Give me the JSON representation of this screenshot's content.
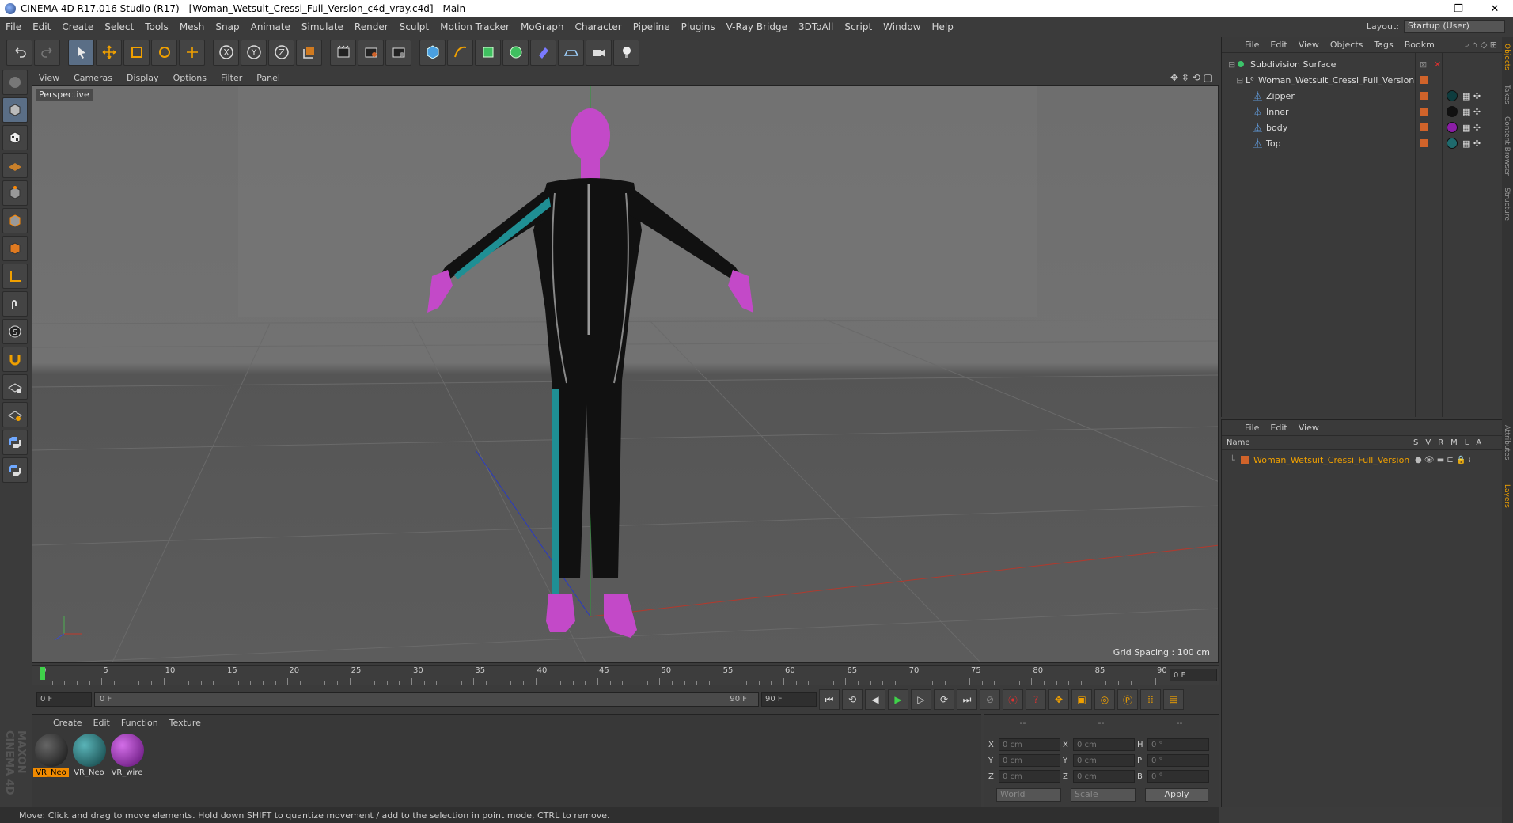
{
  "window": {
    "title": "CINEMA 4D R17.016 Studio (R17) - [Woman_Wetsuit_Cressi_Full_Version_c4d_vray.c4d] - Main",
    "min": "—",
    "restore": "❐",
    "close": "✕"
  },
  "menu": [
    "File",
    "Edit",
    "Create",
    "Select",
    "Tools",
    "Mesh",
    "Snap",
    "Animate",
    "Simulate",
    "Render",
    "Sculpt",
    "Motion Tracker",
    "MoGraph",
    "Character",
    "Pipeline",
    "Plugins",
    "V-Ray Bridge",
    "3DToAll",
    "Script",
    "Window",
    "Help"
  ],
  "layout": {
    "label": "Layout:",
    "value": "Startup (User)"
  },
  "viewport": {
    "menu": [
      "View",
      "Cameras",
      "Display",
      "Options",
      "Filter",
      "Panel"
    ],
    "camera": "Perspective",
    "grid_spacing": "Grid Spacing : 100 cm"
  },
  "timeline": {
    "ticks": [
      "0",
      "5",
      "10",
      "15",
      "20",
      "25",
      "30",
      "35",
      "40",
      "45",
      "50",
      "55",
      "60",
      "65",
      "70",
      "75",
      "80",
      "85",
      "90"
    ],
    "end_field": "0 F",
    "current_frame": "0 F",
    "range_start": "0 F",
    "range_end": "90 F",
    "max_frame": "90 F"
  },
  "materials": {
    "menu": [
      "Create",
      "Edit",
      "Function",
      "Texture"
    ],
    "items": [
      {
        "name": "VR_Neo",
        "color": "#1e1e1e",
        "selected": true
      },
      {
        "name": "VR_Neo",
        "color": "#1d6a6d",
        "selected": false
      },
      {
        "name": "VR_wire",
        "color": "#8b1ea6",
        "selected": false
      }
    ]
  },
  "coords": {
    "header": [
      "--",
      "--",
      "--"
    ],
    "rows": [
      {
        "a": "X",
        "av": "0 cm",
        "b": "X",
        "bv": "0 cm",
        "c": "H",
        "cv": "0 °"
      },
      {
        "a": "Y",
        "av": "0 cm",
        "b": "Y",
        "bv": "0 cm",
        "c": "P",
        "cv": "0 °"
      },
      {
        "a": "Z",
        "av": "0 cm",
        "b": "Z",
        "bv": "0 cm",
        "c": "B",
        "cv": "0 °"
      }
    ],
    "space": "World",
    "mode": "Scale",
    "apply": "Apply"
  },
  "objects": {
    "menu": [
      "File",
      "Edit",
      "View",
      "Objects",
      "Tags",
      "Bookm"
    ],
    "tree": [
      {
        "name": "Subdivision Surface",
        "depth": 0
      },
      {
        "name": "Woman_Wetsuit_Cressi_Full_Version",
        "depth": 1
      },
      {
        "name": "Zipper",
        "depth": 2
      },
      {
        "name": "Inner",
        "depth": 2
      },
      {
        "name": "body",
        "depth": 2
      },
      {
        "name": "Top",
        "depth": 2
      }
    ]
  },
  "layers": {
    "menu": [
      "File",
      "Edit",
      "View"
    ],
    "columns": {
      "name": "Name",
      "flags": [
        "S",
        "V",
        "R",
        "M",
        "L",
        "A"
      ]
    },
    "rows": [
      {
        "name": "Woman_Wetsuit_Cressi_Full_Version",
        "color": "#d0632a"
      }
    ]
  },
  "side_tabs": [
    "Objects",
    "Takes",
    "Content Browser",
    "Structure",
    "Attributes",
    "Layers"
  ],
  "brand": "MAXON CINEMA 4D",
  "status": "Move: Click and drag to move elements. Hold down SHIFT to quantize movement / add to the selection in point mode, CTRL to remove.",
  "colors": {
    "accent": "#f08a00",
    "skin": "#c349c8",
    "suit_stripe": "#1f8f94"
  }
}
